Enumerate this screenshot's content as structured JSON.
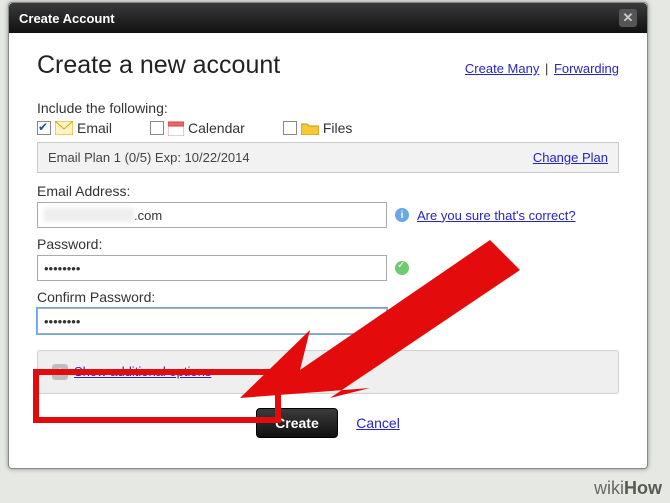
{
  "titlebar": {
    "title": "Create Account"
  },
  "header": {
    "heading": "Create a new account",
    "link_create_many": "Create Many",
    "link_forwarding": "Forwarding"
  },
  "include": {
    "label": "Include the following:",
    "email": "Email",
    "calendar": "Calendar",
    "files": "Files",
    "email_checked": true,
    "calendar_checked": false,
    "files_checked": false
  },
  "plan": {
    "text": "Email Plan 1 (0/5) Exp: 10/22/2014",
    "change_link": "Change Plan"
  },
  "email_field": {
    "label": "Email Address:",
    "domain_suffix": ".com",
    "hint_link": "Are you sure that's correct?"
  },
  "password_field": {
    "label": "Password:",
    "value": "••••••••"
  },
  "confirm_field": {
    "label": "Confirm Password:",
    "value": "••••••••"
  },
  "additional": {
    "link": "Show additional options"
  },
  "footer": {
    "create": "Create",
    "cancel": "Cancel"
  },
  "watermark": {
    "prefix": "wiki",
    "suffix": "How"
  }
}
